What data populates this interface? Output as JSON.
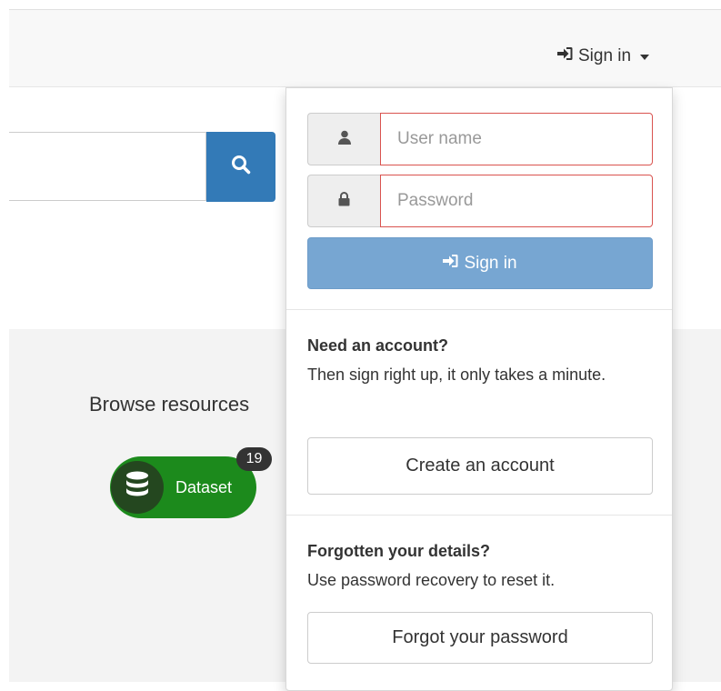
{
  "navbar": {
    "signin_label": "Sign in"
  },
  "search": {
    "placeholder": ""
  },
  "browse": {
    "title": "Browse resources",
    "dataset_label": "Dataset",
    "dataset_count": "19"
  },
  "login": {
    "username_placeholder": "User name",
    "password_placeholder": "Password",
    "signin_button": "Sign in"
  },
  "account": {
    "heading": "Need an account?",
    "text": "Then sign right up, it only takes a minute.",
    "button": "Create an account"
  },
  "recovery": {
    "heading": "Forgotten your details?",
    "text": "Use password recovery to reset it.",
    "button": "Forgot your password"
  },
  "colors": {
    "primary": "#337ab7",
    "primary_disabled": "#77a6d2",
    "error_border": "#d9534f",
    "dataset_green": "#1c8a1c"
  },
  "icons": [
    "sign-in-icon",
    "caret-down-icon",
    "search-icon",
    "user-icon",
    "lock-icon",
    "database-icon"
  ]
}
